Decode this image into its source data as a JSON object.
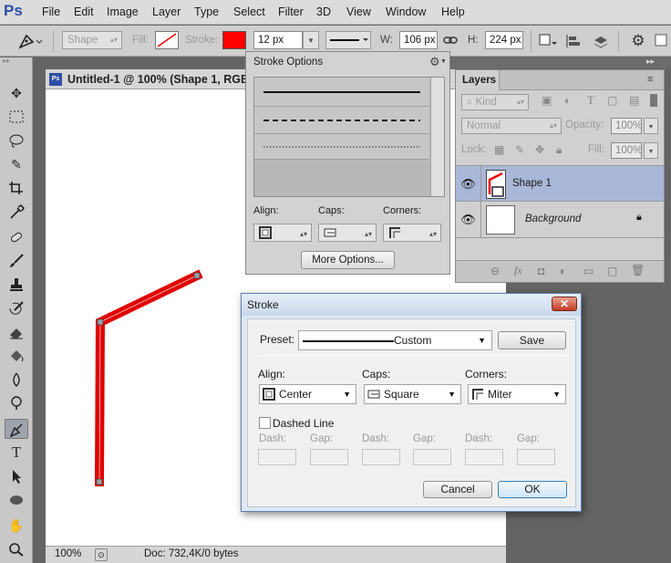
{
  "app_logo": "Ps",
  "menu": [
    "File",
    "Edit",
    "Image",
    "Layer",
    "Type",
    "Select",
    "Filter",
    "3D",
    "View",
    "Window",
    "Help"
  ],
  "options_bar": {
    "mode": "Shape",
    "fill_label": "Fill:",
    "stroke_label": "Stroke:",
    "stroke_color": "#ff0000",
    "stroke_width": "12 px",
    "w_label": "W:",
    "w_value": "106 px",
    "h_label": "H:",
    "h_value": "224 px"
  },
  "document": {
    "tab_title": "Untitled-1 @ 100% (Shape 1, RGB/8",
    "zoom": "100%",
    "doc_info": "Doc: 732,4K/0 bytes",
    "stroke_color": "#e00000"
  },
  "stroke_options_panel": {
    "title": "Stroke Options",
    "align_label": "Align:",
    "caps_label": "Caps:",
    "corners_label": "Corners:",
    "more_options": "More Options..."
  },
  "layers_panel": {
    "title": "Layers",
    "kind": "Kind",
    "blend_mode": "Normal",
    "opacity_label": "Opacity:",
    "opacity_value": "100%",
    "lock_label": "Lock:",
    "fill_label": "Fill:",
    "fill_value": "100%",
    "layers": [
      {
        "name": "Shape 1"
      },
      {
        "name": "Background"
      }
    ]
  },
  "stroke_dialog": {
    "title": "Stroke",
    "preset_label": "Preset:",
    "preset_value": "Custom",
    "save_button": "Save",
    "align_label": "Align:",
    "align_value": "Center",
    "caps_label": "Caps:",
    "caps_value": "Square",
    "corners_label": "Corners:",
    "corners_value": "Miter",
    "dashed_line_label": "Dashed Line",
    "dashed_line_checked": false,
    "dash_label": "Dash:",
    "gap_label": "Gap:",
    "cancel_button": "Cancel",
    "ok_button": "OK"
  }
}
